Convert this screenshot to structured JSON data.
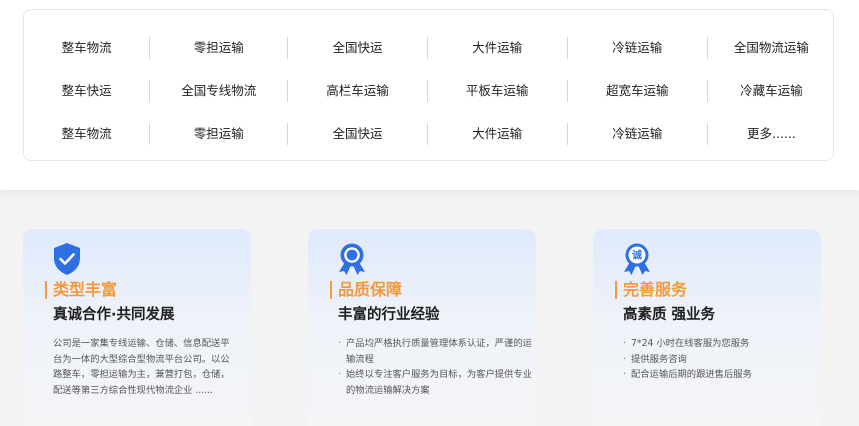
{
  "service_grid": {
    "rows": [
      [
        "整车物流",
        "零担运输",
        "全国快运",
        "大件运输",
        "冷链运输",
        "全国物流运输"
      ],
      [
        "整车快运",
        "全国专线物流",
        "高栏车运输",
        "平板车运输",
        "超宽车运输",
        "冷藏车运输"
      ],
      [
        "整车物流",
        "零担运输",
        "全国快运",
        "大件运输",
        "冷链运输",
        "更多......"
      ]
    ]
  },
  "features": [
    {
      "icon": "shield-check-icon",
      "tag": "类型丰富",
      "title": "真诚合作·共同发展",
      "description": "公司是一家集专线运输、仓储、信息配送平台为一体的大型综合型物流平台公司。以公路整车，零担运输为主，兼营打包，仓储，配送等第三方综合性现代物流企业 ......"
    },
    {
      "icon": "award-medal-icon",
      "tag": "品质保障",
      "title": "丰富的行业经验",
      "bullets": [
        "产品均严格执行质量管理体系认证，严谨的运输流程",
        "始终以专注客户服务为目标，为客户提供专业的物流运输解决方案"
      ]
    },
    {
      "icon": "integrity-badge-icon",
      "icon_text": "诚",
      "tag": "完善服务",
      "title": "高素质 强业务",
      "bullets": [
        "7*24 小时在线客服为您服务",
        "提供服务咨询",
        "配合运输后期的跟进售后服务"
      ]
    }
  ],
  "colors": {
    "accent_orange": "#f29a3a",
    "icon_blue": "#2f6fe4",
    "card_gradient_top": "#e0eafc"
  }
}
